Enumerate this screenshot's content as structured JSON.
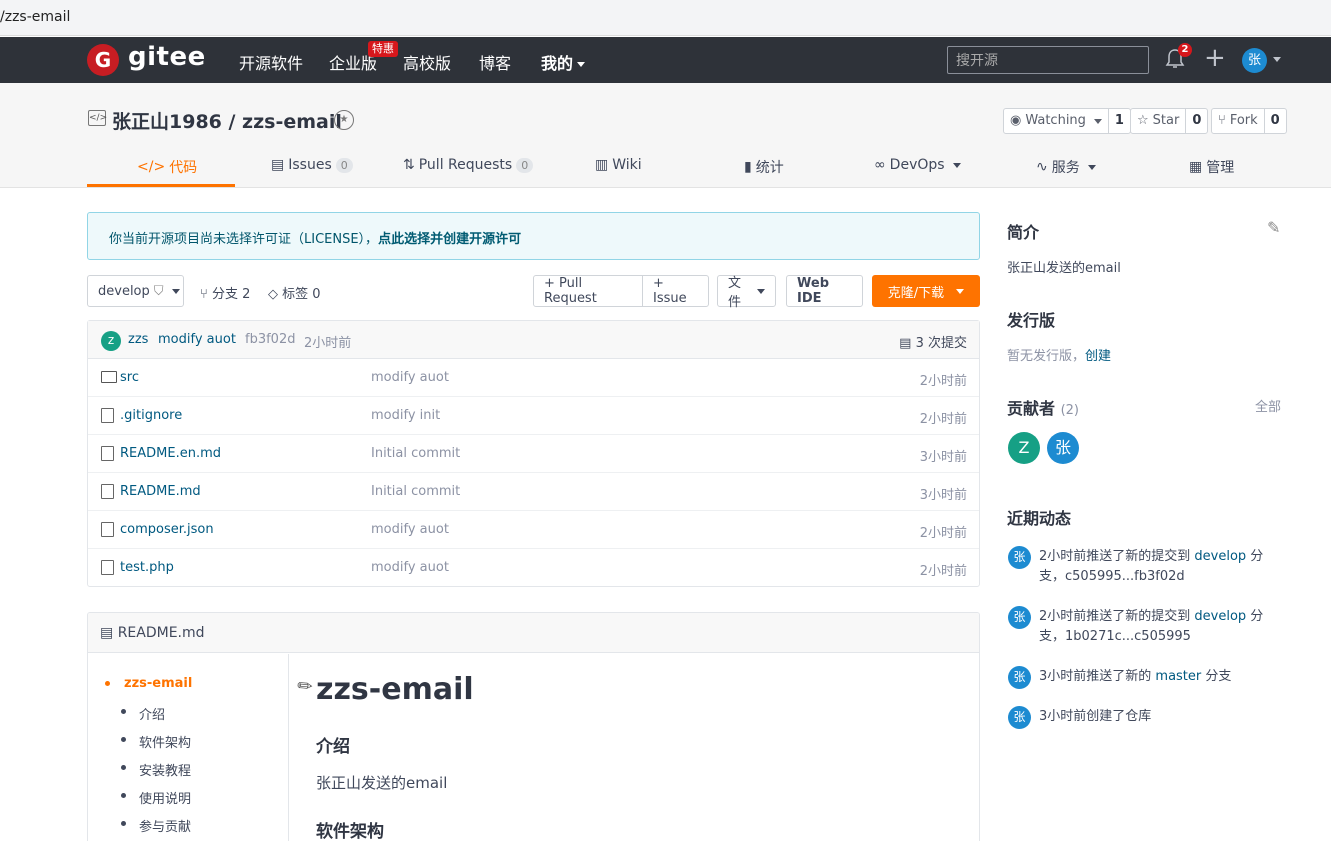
{
  "browser": {
    "url_fragment": "/zzs-email"
  },
  "nav": {
    "logo_letter": "G",
    "logo_text": "gitee",
    "items": [
      {
        "label": "开源软件"
      },
      {
        "label": "企业版"
      },
      {
        "label": "高校版"
      },
      {
        "label": "博客"
      },
      {
        "label": "我的"
      }
    ],
    "hot_badge": "特惠",
    "search_placeholder": "搜开源",
    "notification_count": "2",
    "plus": "+",
    "avatar": "张"
  },
  "repo": {
    "icon_glyph": "</>",
    "title": "张正山1986 / zzs-email",
    "watch": {
      "label": "Watching",
      "count": "1"
    },
    "star": {
      "label": "Star",
      "count": "0"
    },
    "fork": {
      "label": "Fork",
      "count": "0"
    }
  },
  "tabs": [
    {
      "label": "代码",
      "icon": "</>"
    },
    {
      "label": "Issues",
      "count": "0"
    },
    {
      "label": "Pull Requests",
      "count": "0"
    },
    {
      "label": "Wiki"
    },
    {
      "label": "统计"
    },
    {
      "label": "DevOps"
    },
    {
      "label": "服务"
    },
    {
      "label": "管理"
    }
  ],
  "license_notice": {
    "text": "你当前开源项目尚未选择许可证（LICENSE），",
    "link": "点此选择并创建开源许可"
  },
  "toolbar": {
    "branch": "develop",
    "branches": "分支 2",
    "tags": "标签 0",
    "pull_request": "+ Pull Request",
    "issue": "+ Issue",
    "file": "文件",
    "web_ide": "Web IDE",
    "clone": "克隆/下载"
  },
  "commit": {
    "avatar": "z",
    "author": "zzs",
    "message": "modify auot",
    "hash": "fb3f02d",
    "time": "2小时前",
    "count": "3 次提交"
  },
  "files": [
    {
      "name": "src",
      "message": "modify auot",
      "time": "2小时前",
      "type": "folder"
    },
    {
      "name": ".gitignore",
      "message": "modify init",
      "time": "2小时前",
      "type": "file"
    },
    {
      "name": "README.en.md",
      "message": "Initial commit",
      "time": "3小时前",
      "type": "file"
    },
    {
      "name": "README.md",
      "message": "Initial commit",
      "time": "3小时前",
      "type": "file"
    },
    {
      "name": "composer.json",
      "message": "modify auot",
      "time": "2小时前",
      "type": "file"
    },
    {
      "name": "test.php",
      "message": "modify auot",
      "time": "2小时前",
      "type": "file"
    }
  ],
  "readme": {
    "file_label": "README.md",
    "toc": [
      "zzs-email",
      "介绍",
      "软件架构",
      "安装教程",
      "使用说明",
      "参与贡献"
    ],
    "h1": "zzs-email",
    "h2_intro": "介绍",
    "intro_text": "张正山发送的email",
    "h2_arch": "软件架构"
  },
  "sidebar": {
    "about_title": "简介",
    "about_text": "张正山发送的email",
    "release_title": "发行版",
    "release_text": "暂无发行版，",
    "release_link": "创建",
    "contributors_title": "贡献者",
    "contributors_count": "(2)",
    "contributors_all": "全部",
    "contributors": [
      {
        "initial": "Z",
        "color": "#16a085"
      },
      {
        "initial": "张",
        "color": "#1d8bd1"
      }
    ],
    "activity_title": "近期动态",
    "activities": [
      {
        "avatar": "张",
        "pre": "2小时前推送了新的提交到 ",
        "link": "develop",
        "post": " 分支，c505995...fb3f02d"
      },
      {
        "avatar": "张",
        "pre": "2小时前推送了新的提交到 ",
        "link": "develop",
        "post": " 分支，1b0271c...c505995"
      },
      {
        "avatar": "张",
        "pre": "3小时前推送了新的 ",
        "link": "master",
        "post": " 分支"
      },
      {
        "avatar": "张",
        "pre": "3小时前创建了仓库",
        "link": "",
        "post": ""
      }
    ]
  },
  "colors": {
    "nav_bg": "#2e3239",
    "accent": "#fe7300",
    "link": "#005980",
    "brand_red": "#c71d23"
  }
}
